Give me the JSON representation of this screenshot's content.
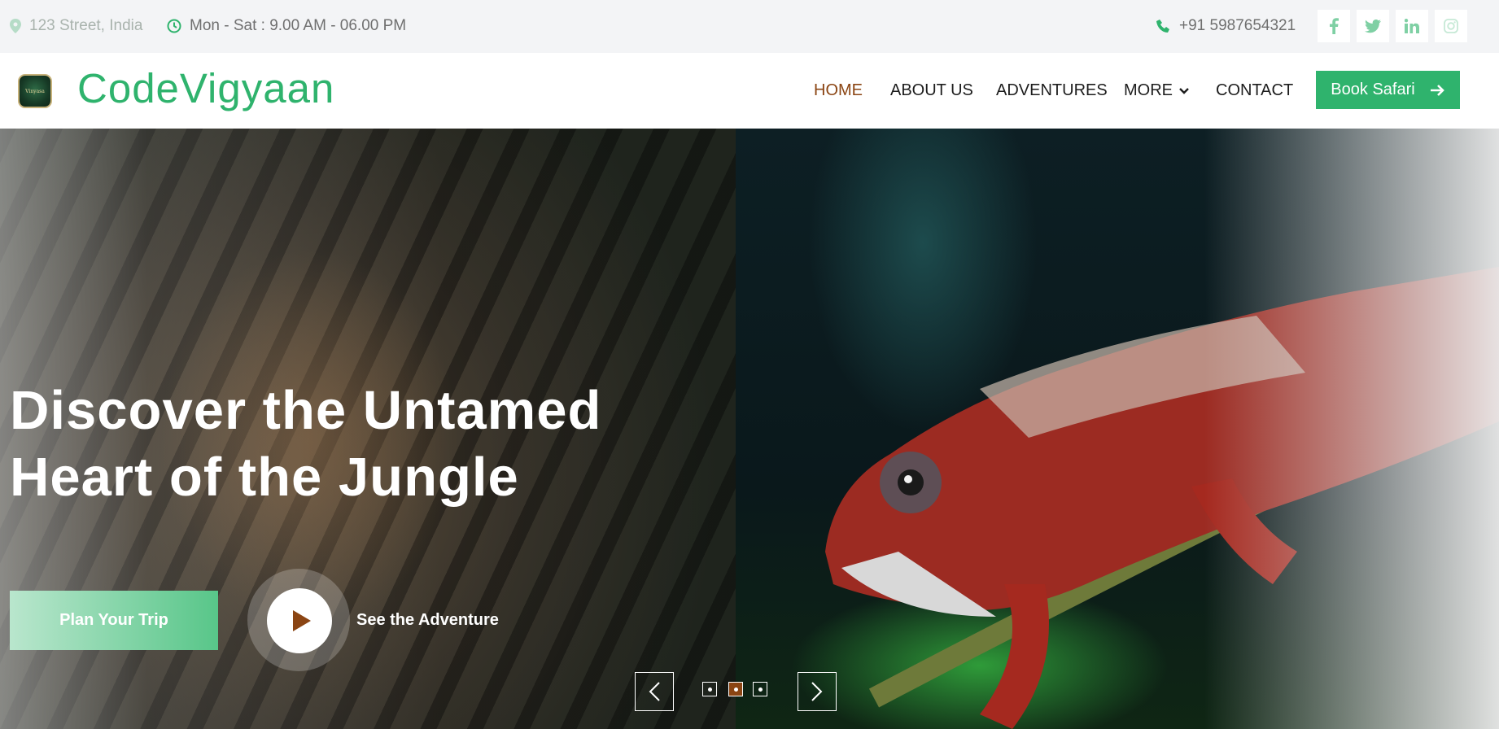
{
  "topbar": {
    "address": "123 Street, India",
    "hours": "Mon - Sat : 9.00 AM - 06.00 PM",
    "phone": "+91 5987654321",
    "socials": [
      "facebook-icon",
      "twitter-icon",
      "linkedin-icon",
      "instagram-icon"
    ]
  },
  "brand": {
    "name": "CodeVigyaan",
    "logo_text": "Vinyasa"
  },
  "nav": {
    "items": [
      {
        "label": "HOME",
        "active": true
      },
      {
        "label": "ABOUT US"
      },
      {
        "label": "ADVENTURES"
      },
      {
        "label": "MORE"
      },
      {
        "label": "CONTACT"
      }
    ],
    "cta": "Book Safari"
  },
  "hero": {
    "headline_line1": "Discover the Untamed",
    "headline_line2": "Heart of the Jungle",
    "primary_button": "Plan Your Trip",
    "video_label": "See the Adventure",
    "slides": 3,
    "active_slide": 2
  },
  "colors": {
    "accent": "#2fb36d",
    "active_nav": "#8b4513",
    "text_dark": "#1d1d1d"
  }
}
